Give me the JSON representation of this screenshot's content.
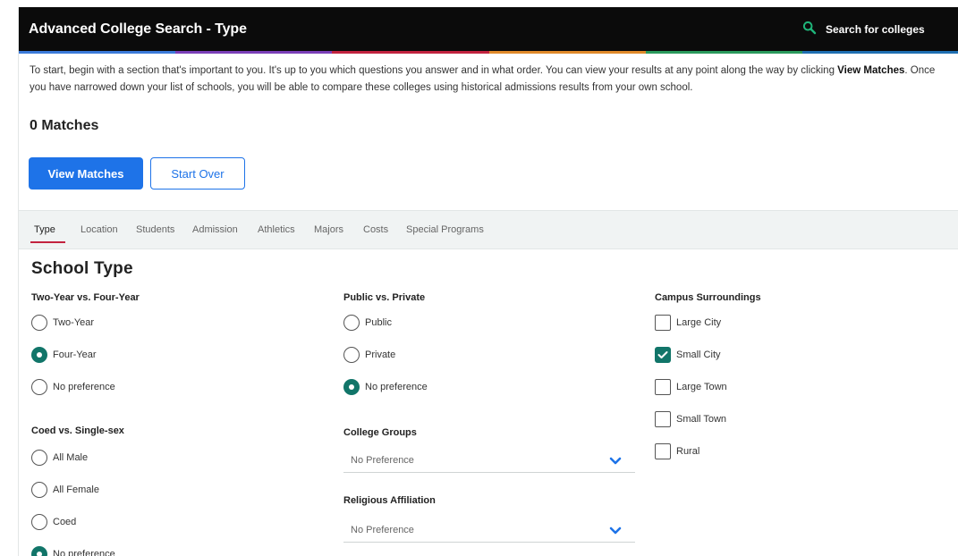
{
  "header": {
    "title": "Advanced College Search - Type",
    "search_label": "Search for colleges",
    "stripe_colors": [
      "#3b7ad9",
      "#7b3fb8",
      "#c2233f",
      "#e08a2a",
      "#2a9a5c",
      "#1f6fb2"
    ]
  },
  "intro": {
    "part1": "To start, begin with a section that's important to you. It's up to you which questions you answer and in what order. You can view your results at any point along the way by clicking ",
    "bold": "View Matches",
    "part2": ". Once you have narrowed down your list of schools, you will be able to compare these colleges using historical admissions results from your own school."
  },
  "matches_label": "0 Matches",
  "buttons": {
    "view_matches": "View Matches",
    "start_over": "Start Over"
  },
  "tabs": [
    {
      "label": "Type",
      "active": true
    },
    {
      "label": "Location"
    },
    {
      "label": "Students"
    },
    {
      "label": "Admission"
    },
    {
      "label": "Athletics"
    },
    {
      "label": "Majors"
    },
    {
      "label": "Costs"
    },
    {
      "label": "Special Programs"
    }
  ],
  "section_title": "School Type",
  "two_four": {
    "label": "Two-Year vs. Four-Year",
    "options": [
      "Two-Year",
      "Four-Year",
      "No preference"
    ],
    "selected": 1
  },
  "coed": {
    "label": "Coed vs. Single-sex",
    "options": [
      "All Male",
      "All Female",
      "Coed",
      "No preference"
    ],
    "selected": 3
  },
  "public_private": {
    "label": "Public vs. Private",
    "options": [
      "Public",
      "Private",
      "No preference"
    ],
    "selected": 2
  },
  "college_groups": {
    "label": "College Groups",
    "value": "No Preference"
  },
  "religious": {
    "label": "Religious Affiliation",
    "value": "No Preference"
  },
  "campus": {
    "label": "Campus Surroundings",
    "options": [
      {
        "label": "Large City",
        "checked": false
      },
      {
        "label": "Small City",
        "checked": true
      },
      {
        "label": "Large Town",
        "checked": false
      },
      {
        "label": "Small Town",
        "checked": false
      },
      {
        "label": "Rural",
        "checked": false
      }
    ]
  },
  "colors": {
    "accent": "#1e73e8",
    "selected": "#117569",
    "tab_underline": "#c2233f",
    "search_icon": "#1fb57a"
  }
}
